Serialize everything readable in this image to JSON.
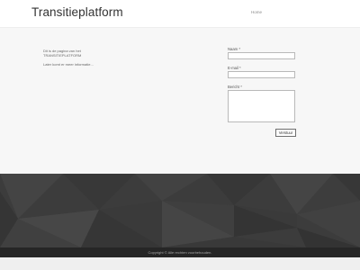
{
  "header": {
    "site_title": "Transitieplatform",
    "nav": [
      {
        "label": "Home"
      }
    ]
  },
  "main": {
    "intro_line1": "Dit is de pagina van het TRANSITIEPLATFORM",
    "intro_line2": "Later komt er meer informatie..."
  },
  "contact_form": {
    "name_label": "Naam *",
    "email_label": "E-mail *",
    "message_label": "Bericht *",
    "submit_label": "Verstuur"
  },
  "footer": {
    "copyright": "Copyright © Alle rechten voorbehouden."
  },
  "colors": {
    "page_background": "#f7f7f7",
    "footer_band": "#3c3c3c",
    "copyright_bar": "#262626"
  }
}
